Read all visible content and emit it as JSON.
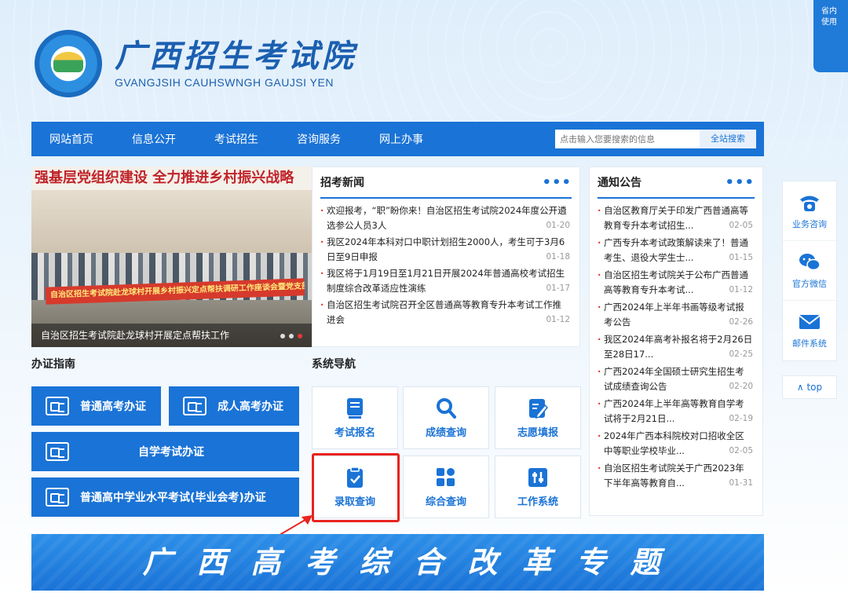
{
  "corner_tab": {
    "line1": "省内",
    "line2": "使用"
  },
  "header": {
    "title_cn": "广西招生考试院",
    "title_en": "GVANGJSIH CAUHSWNGH GAUJSI YEN"
  },
  "nav": {
    "items": [
      "网站首页",
      "信息公开",
      "考试招生",
      "咨询服务",
      "网上办事"
    ],
    "search_placeholder": "点击输入您要搜索的信息",
    "search_button": "全站搜索"
  },
  "carousel": {
    "banner_text": "强基层党组织建设  全力推进乡村振兴战略",
    "red_banner": "自治区招生考试院赴龙球村开展乡村振兴定点帮扶调研工作座谈会暨党支部结对共建活动",
    "caption": "自治区招生考试院赴龙球村开展定点帮扶工作"
  },
  "news": {
    "title": "招考新闻",
    "more": "•••",
    "items": [
      {
        "text": "欢迎报考，“职”盼你来！自治区招生考试院2024年度公开遴选参公人员3人",
        "date": "01-20"
      },
      {
        "text": "我区2024年本科对口中职计划招生2000人，考生可于3月6日至9日申报",
        "date": "01-18"
      },
      {
        "text": "我区将于1月19日至1月21日开展2024年普通高校考试招生制度综合改革适应性演练",
        "date": "01-17"
      },
      {
        "text": "自治区招生考试院召开全区普通高等教育专升本考试工作推进会",
        "date": "01-12"
      }
    ]
  },
  "notices": {
    "title": "通知公告",
    "more": "•••",
    "items": [
      {
        "text": "自治区教育厅关于印发广西普通高等教育专升本考试招生...",
        "date": "02-05"
      },
      {
        "text": "广西专升本考试政策解读来了！普通考生、退役大学生士...",
        "date": "01-15"
      },
      {
        "text": "自治区招生考试院关于公布广西普通高等教育专升本考试...",
        "date": "01-12"
      },
      {
        "text": "广西2024年上半年书画等级考试报考公告",
        "date": "02-26"
      },
      {
        "text": "我区2024年高考补报名将于2月26日至28日17...",
        "date": "02-25"
      },
      {
        "text": "广西2024年全国硕士研究生招生考试成绩查询公告",
        "date": "02-20"
      },
      {
        "text": "广西2024年上半年高等教育自学考试将于2月21日...",
        "date": "02-19"
      },
      {
        "text": "2024年广西本科院校对口招收全区中等职业学校毕业...",
        "date": "02-05"
      },
      {
        "text": "自治区招生考试院关于广西2023年下半年高等教育自...",
        "date": "01-31"
      }
    ]
  },
  "guide": {
    "title": "办证指南",
    "buttons": [
      "普通高考办证",
      "成人高考办证",
      "自学考试办证",
      "普通高中学业水平考试(毕业会考)办证"
    ]
  },
  "system": {
    "title": "系统导航",
    "tiles": [
      "考试报名",
      "成绩查询",
      "志愿填报",
      "录取查询",
      "综合查询",
      "工作系统"
    ]
  },
  "reform": {
    "text": "广西高考综合改革专题"
  },
  "float": {
    "items": [
      {
        "label": "业务咨询",
        "icon": "phone-icon"
      },
      {
        "label": "官方微信",
        "icon": "wechat-icon"
      },
      {
        "label": "邮件系统",
        "icon": "mail-icon"
      }
    ],
    "top": "top"
  },
  "colors": {
    "primary": "#1a73d6",
    "highlight": "#e8231e"
  }
}
